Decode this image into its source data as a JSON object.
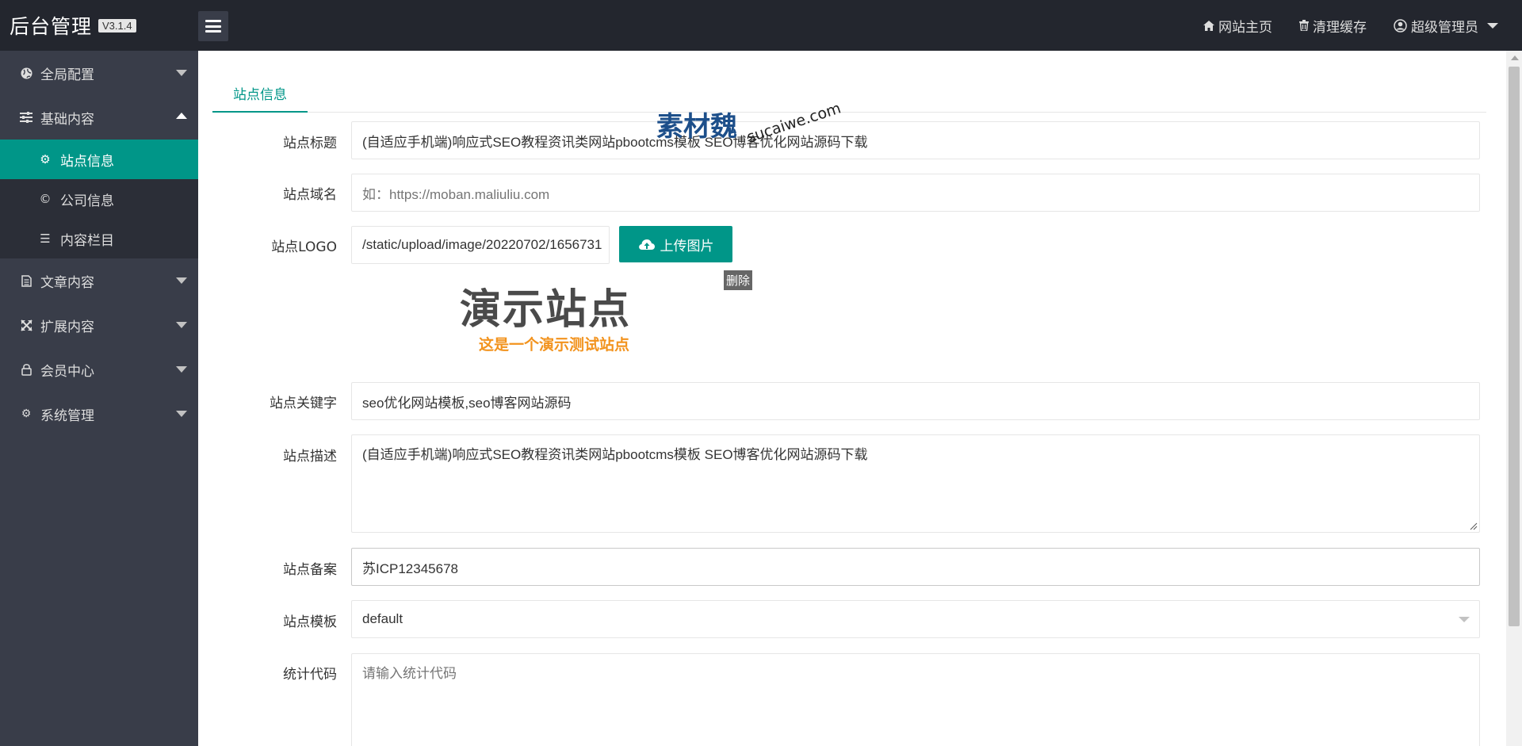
{
  "header": {
    "title": "后台管理",
    "version": "V3.1.4",
    "nav": [
      {
        "icon": "home-icon",
        "label": "网站主页"
      },
      {
        "icon": "trash-icon",
        "label": "清理缓存"
      },
      {
        "icon": "user-circle-icon",
        "label": "超级管理员"
      }
    ]
  },
  "sidebar": {
    "groups": [
      {
        "label": "全局配置",
        "icon": "globe-icon"
      },
      {
        "label": "基础内容",
        "icon": "sliders-icon",
        "expanded": true,
        "children": [
          {
            "label": "站点信息",
            "icon": "gear-icon",
            "active": true
          },
          {
            "label": "公司信息",
            "icon": "copyright-icon"
          },
          {
            "label": "内容栏目",
            "icon": "list-icon"
          }
        ]
      },
      {
        "label": "文章内容",
        "icon": "document-icon"
      },
      {
        "label": "扩展内容",
        "icon": "expand-icon"
      },
      {
        "label": "会员中心",
        "icon": "lock-icon"
      },
      {
        "label": "系统管理",
        "icon": "gear-icon"
      }
    ]
  },
  "tabs": [
    {
      "label": "站点信息",
      "active": true
    }
  ],
  "form": {
    "title": {
      "label": "站点标题",
      "value": "(自适应手机端)响应式SEO教程资讯类网站pbootcms模板 SEO博客优化网站源码下载"
    },
    "domain": {
      "label": "站点域名",
      "placeholder": "如：https://moban.maliuliu.com"
    },
    "logo": {
      "label": "站点LOGO",
      "value": "/static/upload/image/20220702/1656731",
      "upload_label": "上传图片",
      "delete_label": "删除",
      "preview_title": "演示站点",
      "preview_subtitle": "这是一个演示测试站点"
    },
    "keywords": {
      "label": "站点关键字",
      "value": "seo优化网站模板,seo博客网站源码"
    },
    "description": {
      "label": "站点描述",
      "value": "(自适应手机端)响应式SEO教程资讯类网站pbootcms模板 SEO博客优化网站源码下载"
    },
    "icp": {
      "label": "站点备案",
      "value": "苏ICP12345678"
    },
    "template": {
      "label": "站点模板",
      "value": "default"
    },
    "stats": {
      "label": "统计代码",
      "placeholder": "请输入统计代码"
    }
  },
  "watermark": {
    "main": "素材魏",
    "sub": "sucaiwe.com"
  },
  "colors": {
    "accent": "#009688",
    "sidebar_bg": "#393d49",
    "header_bg": "#23262e",
    "submenu_bg": "#2b2e37"
  }
}
